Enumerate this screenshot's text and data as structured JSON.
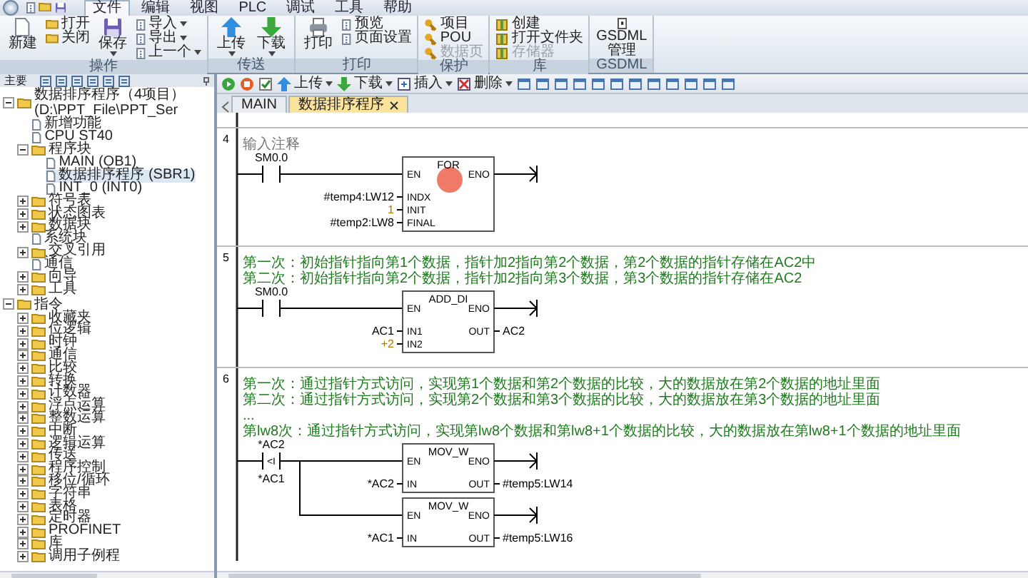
{
  "menu_tabs": [
    {
      "label": "文件",
      "selected": true
    },
    {
      "label": "编辑",
      "selected": false
    },
    {
      "label": "视图",
      "selected": false
    },
    {
      "label": "PLC",
      "selected": false
    },
    {
      "label": "调试",
      "selected": false
    },
    {
      "label": "工具",
      "selected": false
    },
    {
      "label": "帮助",
      "selected": false
    }
  ],
  "ribbon_groups": [
    {
      "title": "操作",
      "items": [
        {
          "kind": "large",
          "label": "新建",
          "dropdown": false
        },
        {
          "kind": "stack",
          "items": [
            {
              "label": "打开",
              "dropdown": false,
              "disabled": false
            },
            {
              "label": "关闭",
              "dropdown": false,
              "disabled": false
            }
          ]
        },
        {
          "kind": "large",
          "label": "保存",
          "dropdown": true
        },
        {
          "kind": "stack",
          "items": [
            {
              "label": "导入",
              "dropdown": true,
              "disabled": false
            },
            {
              "label": "导出",
              "dropdown": true,
              "disabled": false
            },
            {
              "label": "上一个",
              "dropdown": true,
              "disabled": false
            }
          ]
        }
      ]
    },
    {
      "title": "传送",
      "items": [
        {
          "kind": "large",
          "label": "上传",
          "dropdown": true
        },
        {
          "kind": "large",
          "label": "下载",
          "dropdown": true
        }
      ]
    },
    {
      "title": "打印",
      "items": [
        {
          "kind": "large",
          "label": "打印",
          "dropdown": false
        },
        {
          "kind": "stack",
          "items": [
            {
              "label": "预览",
              "dropdown": false,
              "disabled": false
            },
            {
              "label": "页面设置",
              "dropdown": false,
              "disabled": false
            }
          ]
        }
      ]
    },
    {
      "title": "保护",
      "items": [
        {
          "kind": "stack",
          "items": [
            {
              "label": "项目",
              "dropdown": false,
              "disabled": false
            },
            {
              "label": "POU",
              "dropdown": false,
              "disabled": false
            },
            {
              "label": "数据页",
              "dropdown": false,
              "disabled": true
            }
          ]
        }
      ]
    },
    {
      "title": "库",
      "items": [
        {
          "kind": "stack",
          "items": [
            {
              "label": "创建",
              "dropdown": false,
              "disabled": false
            },
            {
              "label": "打开文件夹",
              "dropdown": false,
              "disabled": false
            },
            {
              "label": "存储器",
              "dropdown": false,
              "disabled": true
            }
          ]
        }
      ]
    },
    {
      "title": "GSDML",
      "items": [
        {
          "kind": "large",
          "label": "GSDML管理",
          "dropdown": false
        }
      ]
    }
  ],
  "sidebar": {
    "title": "主要",
    "tree": [
      {
        "label": "数据排序程序（4项目）(D:\\PPT_File\\PPT_Ser",
        "expanded": true,
        "selected": false,
        "children": [
          {
            "label": "新增功能",
            "selected": false
          },
          {
            "label": "CPU ST40",
            "selected": false
          },
          {
            "label": "程序块",
            "expanded": true,
            "selected": false,
            "children": [
              {
                "label": "MAIN (OB1)",
                "selected": false
              },
              {
                "label": "数据排序程序 (SBR1)",
                "selected": true
              },
              {
                "label": "INT_0 (INT0)",
                "selected": false
              }
            ]
          },
          {
            "label": "符号表",
            "expanded": false,
            "selected": false
          },
          {
            "label": "状态图表",
            "expanded": false,
            "selected": false
          },
          {
            "label": "数据块",
            "expanded": false,
            "selected": false
          },
          {
            "label": "系统块",
            "selected": false
          },
          {
            "label": "交叉引用",
            "expanded": false,
            "selected": false
          },
          {
            "label": "通信",
            "selected": false
          },
          {
            "label": "向导",
            "expanded": false,
            "selected": false
          },
          {
            "label": "工具",
            "expanded": false,
            "selected": false
          }
        ]
      },
      {
        "label": "指令",
        "expanded": true,
        "selected": false,
        "children": [
          {
            "label": "收藏夹",
            "expanded": false,
            "selected": false
          },
          {
            "label": "位逻辑",
            "expanded": false,
            "selected": false
          },
          {
            "label": "时钟",
            "expanded": false,
            "selected": false
          },
          {
            "label": "通信",
            "expanded": false,
            "selected": false
          },
          {
            "label": "比较",
            "expanded": false,
            "selected": false
          },
          {
            "label": "转换",
            "expanded": false,
            "selected": false
          },
          {
            "label": "计数器",
            "expanded": false,
            "selected": false
          },
          {
            "label": "浮点运算",
            "expanded": false,
            "selected": false
          },
          {
            "label": "整数运算",
            "expanded": false,
            "selected": false
          },
          {
            "label": "中断",
            "expanded": false,
            "selected": false
          },
          {
            "label": "逻辑运算",
            "expanded": false,
            "selected": false
          },
          {
            "label": "传送",
            "expanded": false,
            "selected": false
          },
          {
            "label": "程序控制",
            "expanded": false,
            "selected": false
          },
          {
            "label": "移位/循环",
            "expanded": false,
            "selected": false
          },
          {
            "label": "字符串",
            "expanded": false,
            "selected": false
          },
          {
            "label": "表格",
            "expanded": false,
            "selected": false
          },
          {
            "label": "定时器",
            "expanded": false,
            "selected": false
          },
          {
            "label": "PROFINET",
            "expanded": false,
            "selected": false
          },
          {
            "label": "库",
            "expanded": false,
            "selected": false
          },
          {
            "label": "调用子例程",
            "expanded": false,
            "selected": false
          }
        ]
      }
    ]
  },
  "editor_toolbar": [
    {
      "label": "上传",
      "dropdown": true
    },
    {
      "label": "下载",
      "dropdown": true
    },
    {
      "label": "插入",
      "dropdown": true
    },
    {
      "label": "删除",
      "dropdown": true
    }
  ],
  "editor_tabs": [
    {
      "label": "MAIN",
      "selected": false,
      "closable": false
    },
    {
      "label": "数据排序程序",
      "selected": true,
      "closable": true
    }
  ],
  "networks": [
    {
      "number": "4",
      "kind": "placeholder",
      "comment": [
        "输入注释"
      ],
      "cursor_highlight": true,
      "contact": {
        "top": "SM0.0"
      },
      "branches": [
        {
          "title": "FOR",
          "en": "EN",
          "eno": "ENO",
          "inputs": [
            {
              "pin": "INDX",
              "operand": "#temp4:LW12",
              "kind": "address"
            },
            {
              "pin": "INIT",
              "operand": "1",
              "kind": "constant"
            },
            {
              "pin": "FINAL",
              "operand": "#temp2:LW8",
              "kind": "address"
            }
          ]
        }
      ]
    },
    {
      "number": "5",
      "kind": "commented",
      "comment": [
        "第一次：初始指针指向第1个数据，指针加2指向第2个数据，第2个数据的指针存储在AC2中",
        "第二次：初始指针指向第2个数据，指针加2指向第3个数据，第3个数据的指针存储在AC2"
      ],
      "cursor_highlight": false,
      "contact": {
        "top": "SM0.0"
      },
      "branches": [
        {
          "title": "ADD_DI",
          "en": "EN",
          "eno": "ENO",
          "inputs": [
            {
              "pin": "IN1",
              "operand": "AC1",
              "kind": "address"
            },
            {
              "pin": "IN2",
              "operand": "+2",
              "kind": "constant"
            }
          ],
          "outputs": [
            {
              "pin": "OUT",
              "operand": "AC2"
            }
          ]
        }
      ]
    },
    {
      "number": "6",
      "kind": "commented",
      "comment": [
        "第一次：通过指针方式访问，实现第1个数据和第2个数据的比较，大的数据放在第2个数据的地址里面",
        "第二次：通过指针方式访问，实现第2个数据和第3个数据的比较，大的数据放在第3个数据的地址里面",
        "...",
        "第lw8次：通过指针方式访问，实现第lw8个数据和第lw8+1个数据的比较，大的数据放在第lw8+1个数据的地址里面"
      ],
      "cursor_highlight": false,
      "contact": {
        "top": "*AC2",
        "symbol": "<I",
        "bottom": "*AC1"
      },
      "branches": [
        {
          "title": "MOV_W",
          "en": "EN",
          "eno": "ENO",
          "inputs": [
            {
              "pin": "IN",
              "operand": "*AC2",
              "kind": "address"
            }
          ],
          "outputs": [
            {
              "pin": "OUT",
              "operand": "#temp5:LW14"
            }
          ]
        },
        {
          "title": "MOV_W",
          "en": "EN",
          "eno": "ENO",
          "inputs": [
            {
              "pin": "IN",
              "operand": "*AC1",
              "kind": "address"
            }
          ],
          "outputs": [
            {
              "pin": "OUT",
              "operand": "#temp5:LW16"
            }
          ]
        }
      ]
    }
  ]
}
